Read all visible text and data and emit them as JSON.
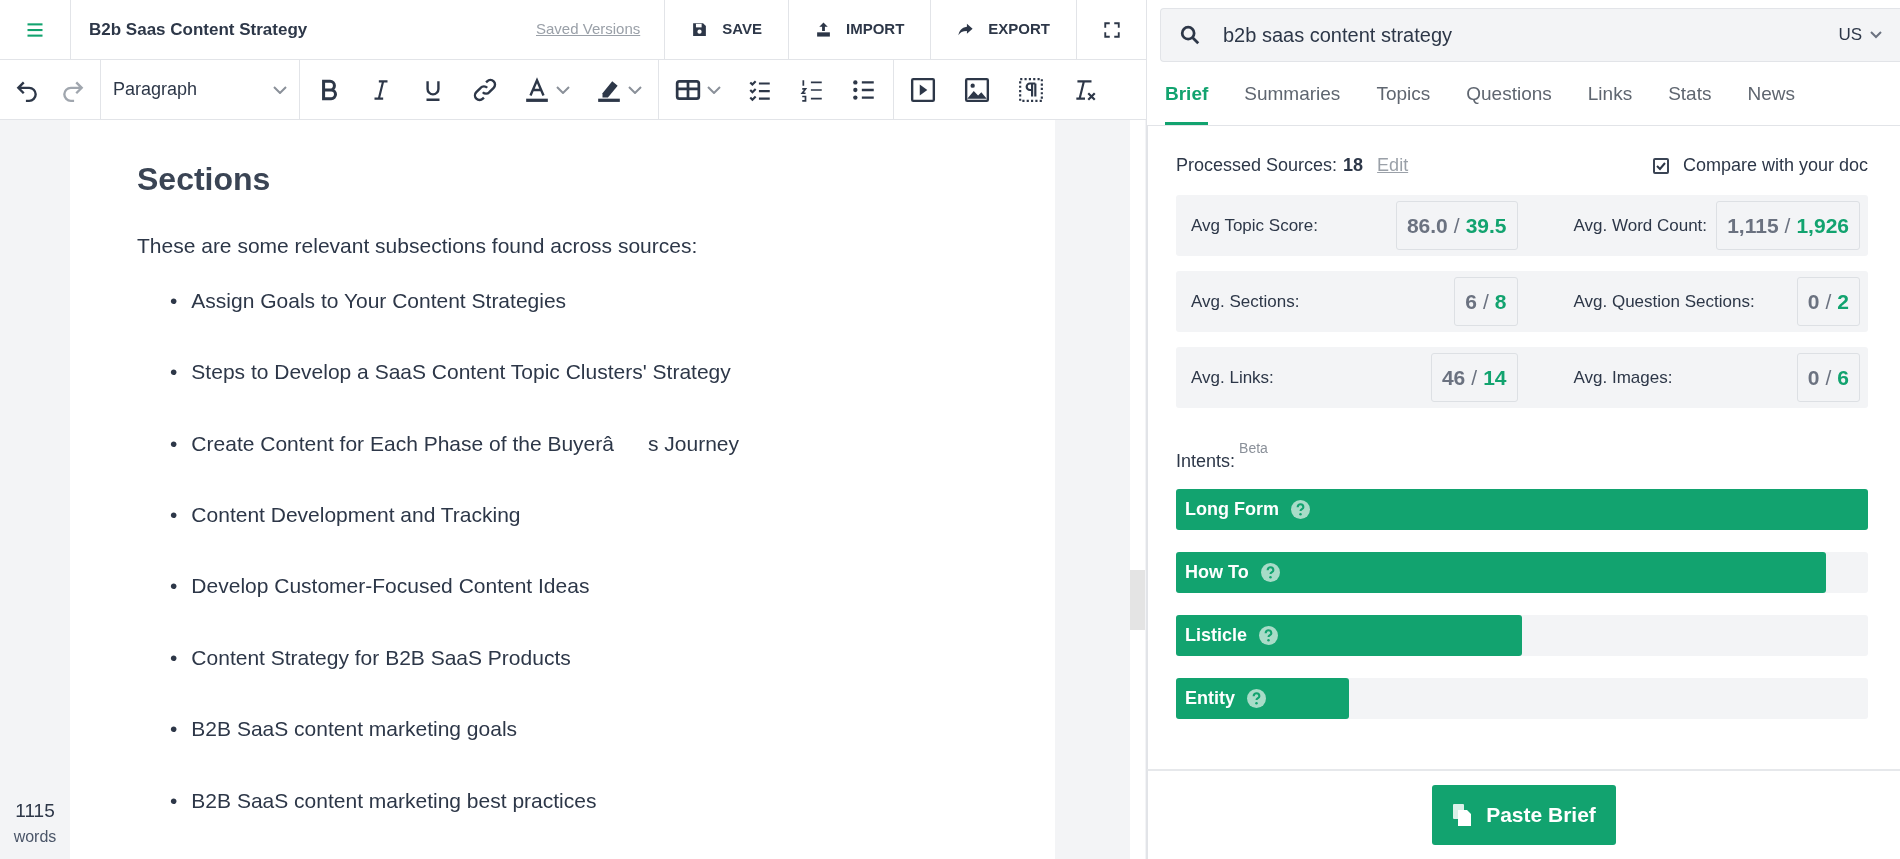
{
  "header": {
    "title": "B2b Saas Content Strategy",
    "saved_versions": "Saved Versions",
    "actions": [
      {
        "kind": "save",
        "label": "SAVE"
      },
      {
        "kind": "import",
        "label": "IMPORT"
      },
      {
        "kind": "export",
        "label": "EXPORT"
      }
    ]
  },
  "toolbar": {
    "undo": {
      "disabled": false
    },
    "redo": {
      "disabled": true
    },
    "block_format": "Paragraph"
  },
  "document": {
    "heading": "Sections",
    "intro": "These are some relevant subsections found across sources:",
    "bullets": [
      {
        "marker": "•",
        "text": "Assign Goals to Your Content Strategies"
      },
      {
        "marker": "•",
        "text": "Steps to Develop a SaaS Content Topic Clusters' Strategy"
      },
      {
        "marker": "•",
        "text": "Create Content for Each Phase of the Buyerâs Journey"
      },
      {
        "marker": "•",
        "text": "Content Development and Tracking"
      },
      {
        "marker": "•",
        "text": "Develop Customer-Focused Content Ideas"
      },
      {
        "marker": "•",
        "text": "Content Strategy for B2B SaaS Products"
      },
      {
        "marker": "•",
        "text": "B2B SaaS content marketing goals"
      },
      {
        "marker": "•",
        "text": "B2B SaaS content marketing best practices"
      }
    ]
  },
  "word_count": {
    "value": "1115",
    "unit": "words"
  },
  "search": {
    "value": "b2b saas content strategy",
    "region": "US"
  },
  "tabs": [
    {
      "label": "Brief",
      "selected": true
    },
    {
      "label": "Summaries",
      "selected": false
    },
    {
      "label": "Topics",
      "selected": false
    },
    {
      "label": "Questions",
      "selected": false
    },
    {
      "label": "Links",
      "selected": false
    },
    {
      "label": "Stats",
      "selected": false
    },
    {
      "label": "News",
      "selected": false
    }
  ],
  "brief": {
    "sources_label": "Processed Sources:",
    "sources_count": "18",
    "edit": "Edit",
    "compare": {
      "label": "Compare with your doc",
      "checked": true
    },
    "stats": [
      {
        "label": "Avg Topic Score:",
        "yours": "86.0",
        "separator": "/",
        "theirs": "39.5"
      },
      {
        "label": "Avg. Word Count:",
        "yours": "1,115",
        "separator": "/",
        "theirs": "1,926"
      },
      {
        "label": "Avg. Sections:",
        "yours": "6",
        "separator": "/",
        "theirs": "8"
      },
      {
        "label": "Avg. Question Sections:",
        "yours": "0",
        "separator": "/",
        "theirs": "2"
      },
      {
        "label": "Avg. Links:",
        "yours": "46",
        "separator": "/",
        "theirs": "14"
      },
      {
        "label": "Avg. Images:",
        "yours": "0",
        "separator": "/",
        "theirs": "6"
      }
    ],
    "intents_label": "Intents:",
    "intents_badge": "Beta",
    "intents": [
      {
        "label": "Long Form",
        "level": 1.0
      },
      {
        "label": "How To",
        "level": 0.94
      },
      {
        "label": "Listicle",
        "level": 0.5
      },
      {
        "label": "Entity",
        "level": 0.25
      }
    ],
    "paste_button": "Paste Brief"
  }
}
